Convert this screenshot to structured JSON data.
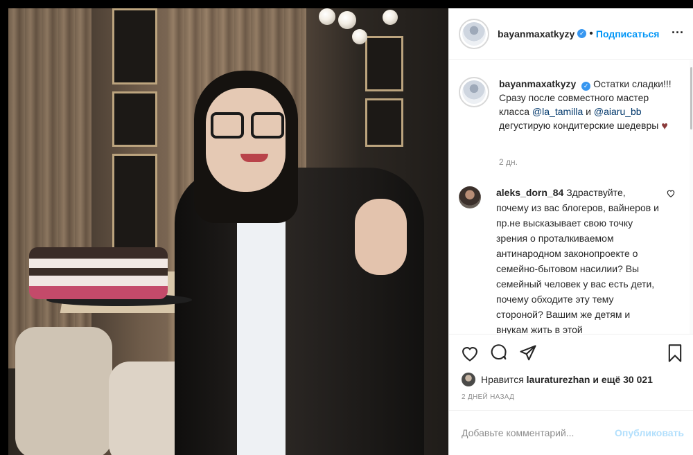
{
  "post": {
    "username": "bayanmaxatkyzy",
    "follow_label": "Подписаться",
    "more_label": "···",
    "caption_text": "Остатки сладки!!! Сразу после совместного мастер класса",
    "mention1": "@la_tamilla",
    "and_word": "и",
    "mention2": "@aiaru_bb",
    "caption_end": "дегустирую кондитерские шедевры",
    "caption_age": "2 дн."
  },
  "comment": {
    "username": "aleks_dorn_84",
    "text": "Здраствуйте, почему из вас блогеров, вайнеров и пр.не высказывает свою точку зрения о проталкиваемом антинародном законопроекте о семейно-бытовом насилии? Вы семейный человек у вас есть дети, почему обходите эту тему стороной? Вашим же детям и внукам жить в этой"
  },
  "likes": {
    "prefix": "Нравится",
    "user": "lauraturezhan",
    "and_more": "и ещё 30 021"
  },
  "date": "2 дней назад",
  "composer": {
    "placeholder": "Добавьте комментарий...",
    "publish_label": "Опубликовать"
  },
  "icons": [
    "heart-icon",
    "comment-icon",
    "share-icon",
    "bookmark-icon",
    "verified-icon",
    "more-icon"
  ],
  "colors": {
    "accent": "#0095f6",
    "verified": "#3897f0",
    "muted": "#8e8e8e",
    "publish_disabled": "#b2dffc"
  }
}
